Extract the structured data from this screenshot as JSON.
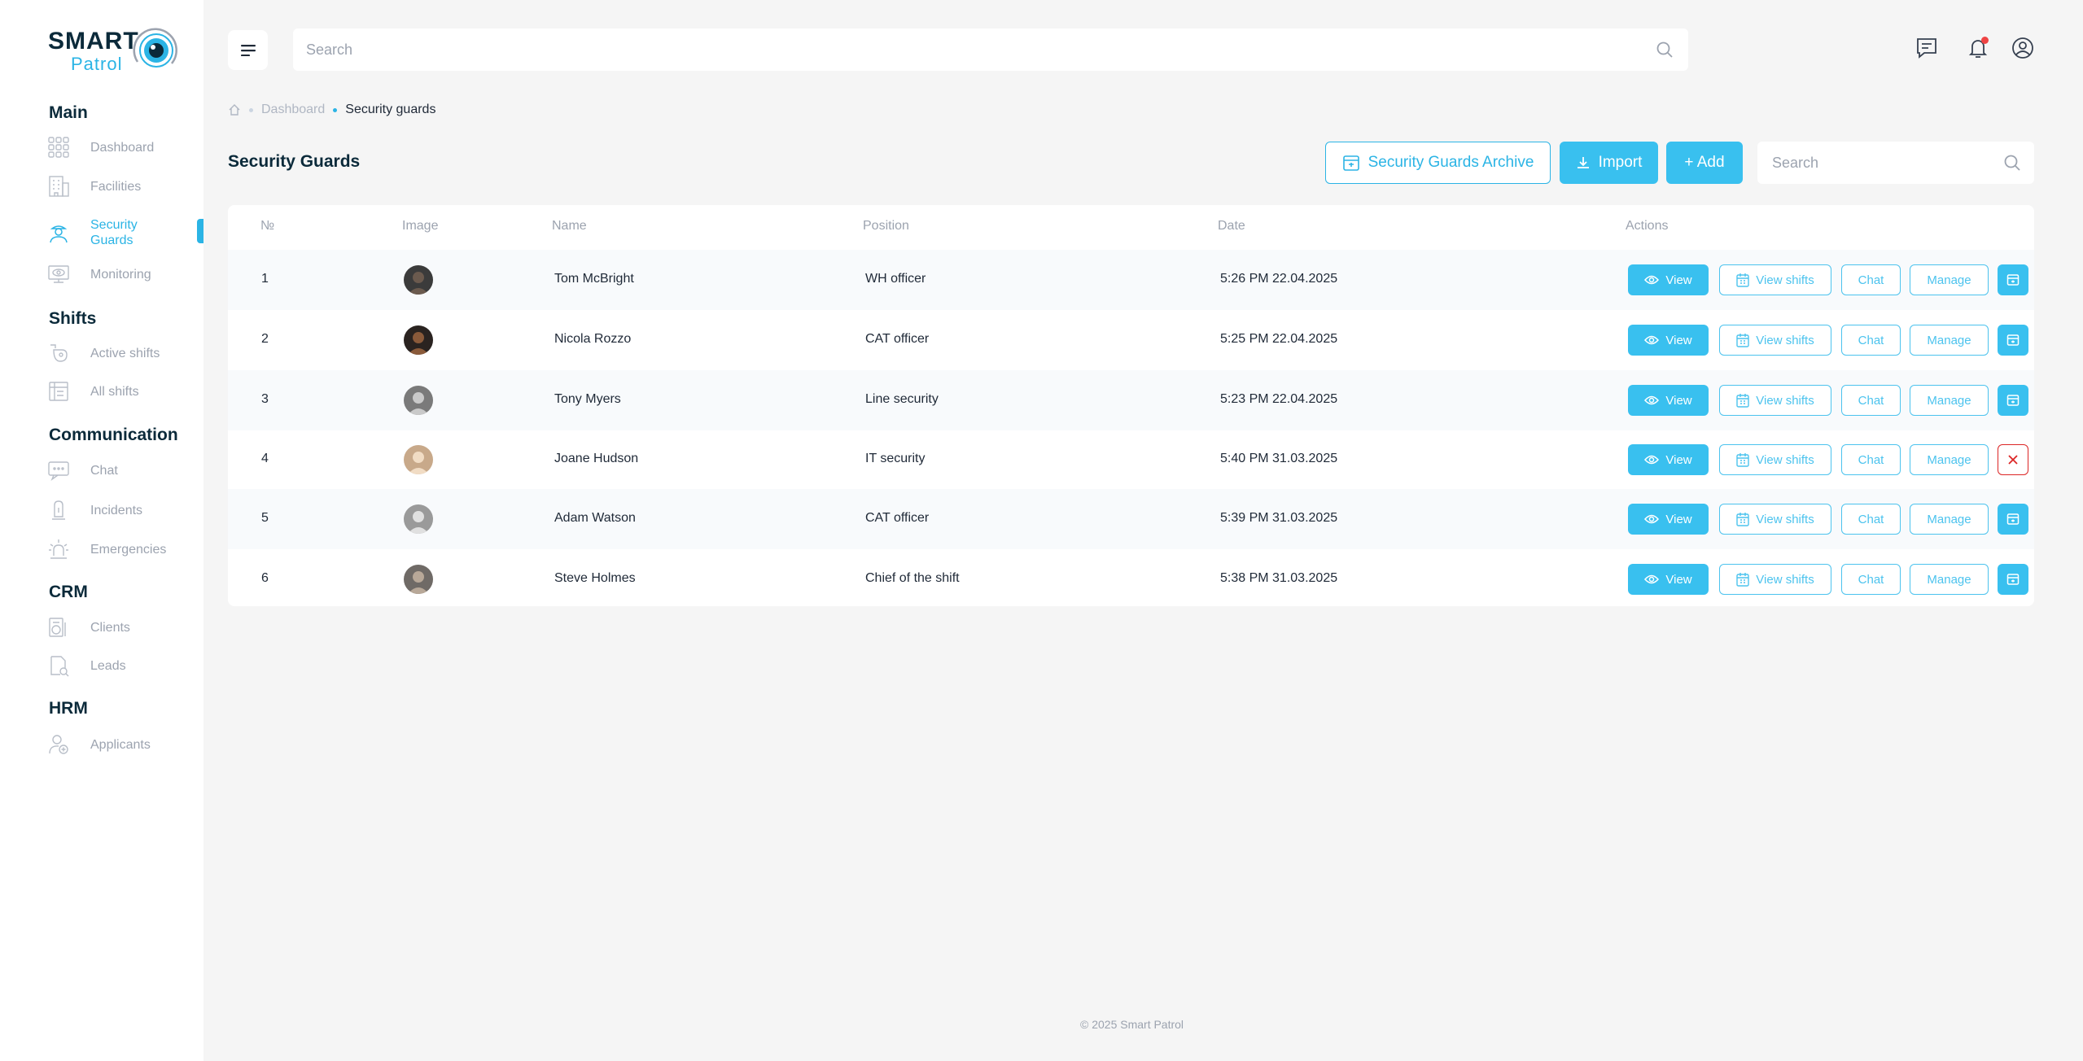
{
  "brand": {
    "name_top": "SMART",
    "name_bottom": "Patrol",
    "accent": "#2bb4e5"
  },
  "sidebar": {
    "sections": [
      {
        "title": "Main",
        "items": [
          {
            "label": "Dashboard",
            "icon": "dashboard-grid-icon"
          },
          {
            "label": "Facilities",
            "icon": "building-icon"
          },
          {
            "label": "Security Guards",
            "icon": "guard-icon",
            "active": true
          },
          {
            "label": "Monitoring",
            "icon": "monitor-eye-icon"
          }
        ]
      },
      {
        "title": "Shifts",
        "items": [
          {
            "label": "Active shifts",
            "icon": "active-shifts-icon"
          },
          {
            "label": "All shifts",
            "icon": "all-shifts-icon"
          }
        ]
      },
      {
        "title": "Communication",
        "items": [
          {
            "label": "Chat",
            "icon": "chat-icon"
          },
          {
            "label": "Incidents",
            "icon": "incidents-icon"
          },
          {
            "label": "Emergencies",
            "icon": "emergency-icon"
          }
        ]
      },
      {
        "title": "CRM",
        "items": [
          {
            "label": "Clients",
            "icon": "clients-icon"
          },
          {
            "label": "Leads",
            "icon": "leads-icon"
          }
        ]
      },
      {
        "title": "HRM",
        "items": [
          {
            "label": "Applicants",
            "icon": "applicants-icon"
          }
        ]
      }
    ]
  },
  "topbar": {
    "search_placeholder": "Search"
  },
  "breadcrumb": {
    "home_icon": "home-icon",
    "items": [
      "Dashboard",
      "Security guards"
    ]
  },
  "page": {
    "title": "Security Guards",
    "archive_label": "Security Guards Archive",
    "import_label": "Import",
    "add_label": "+ Add",
    "search_placeholder": "Search"
  },
  "table": {
    "columns": [
      "№",
      "Image",
      "Name",
      "Position",
      "Date",
      "Actions"
    ],
    "action_labels": {
      "view": "View",
      "view_shifts": "View shifts",
      "chat": "Chat",
      "manage": "Manage"
    },
    "rows": [
      {
        "no": "1",
        "name": "Tom McBright",
        "position": "WH officer",
        "date": "5:26 PM 22.04.2025",
        "last_action": "archive"
      },
      {
        "no": "2",
        "name": "Nicola Rozzo",
        "position": "CAT officer",
        "date": "5:25 PM 22.04.2025",
        "last_action": "archive"
      },
      {
        "no": "3",
        "name": "Tony Myers",
        "position": "Line security",
        "date": "5:23 PM 22.04.2025",
        "last_action": "archive"
      },
      {
        "no": "4",
        "name": "Joane Hudson",
        "position": "IT security",
        "date": "5:40 PM 31.03.2025",
        "last_action": "remove"
      },
      {
        "no": "5",
        "name": "Adam Watson",
        "position": "CAT officer",
        "date": "5:39 PM 31.03.2025",
        "last_action": "archive"
      },
      {
        "no": "6",
        "name": "Steve Holmes",
        "position": "Chief of the shift",
        "date": "5:38 PM 31.03.2025",
        "last_action": "archive"
      }
    ]
  },
  "footer": {
    "text": "© 2025 Smart Patrol"
  }
}
